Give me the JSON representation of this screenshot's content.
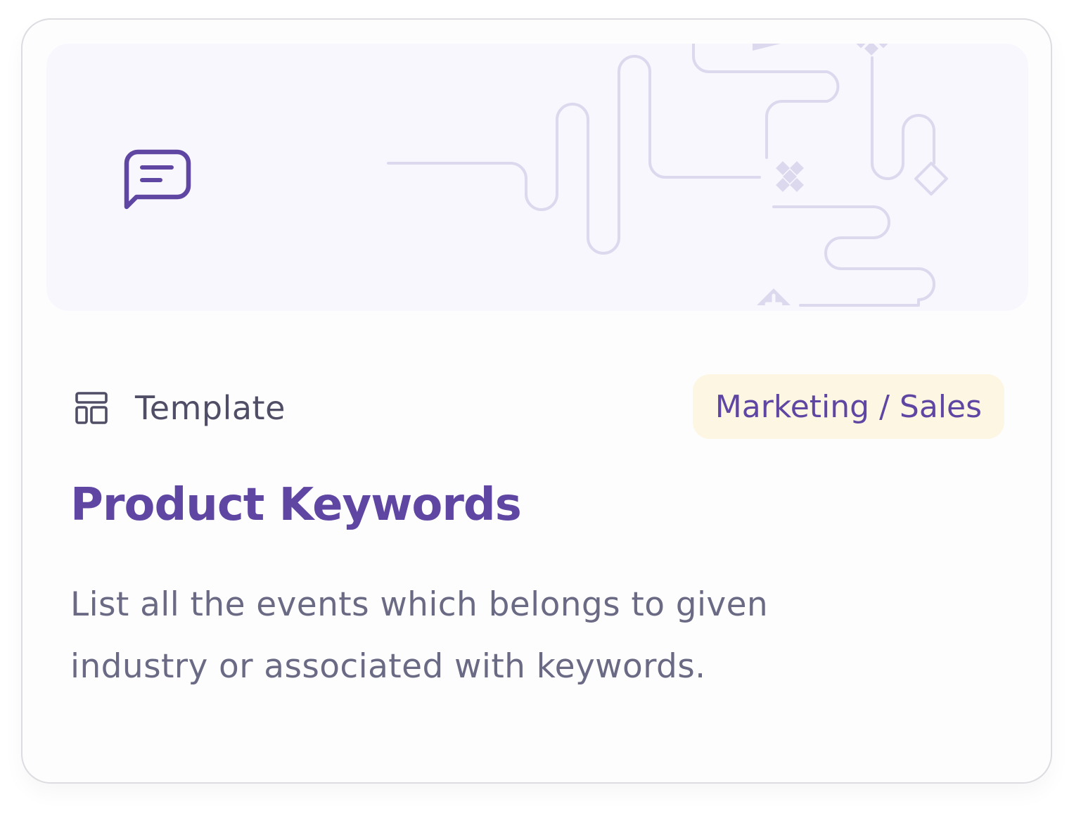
{
  "card": {
    "type_label": "Template",
    "category": "Marketing / Sales",
    "title": "Product Keywords",
    "description": "List all the events which belongs to given industry or associated with keywords."
  },
  "icons": {
    "banner_icon": "chat-message-icon",
    "type_icon": "template-layout-icon",
    "banner_pattern": "decorative-path-pattern"
  },
  "colors": {
    "accent": "#5F46A3",
    "banner_background": "#F8F7FD",
    "pattern_stroke": "#DCD8EE",
    "badge_background": "#FDF6E2",
    "text_secondary": "#6B6A85",
    "border": "#DCDCE1"
  }
}
